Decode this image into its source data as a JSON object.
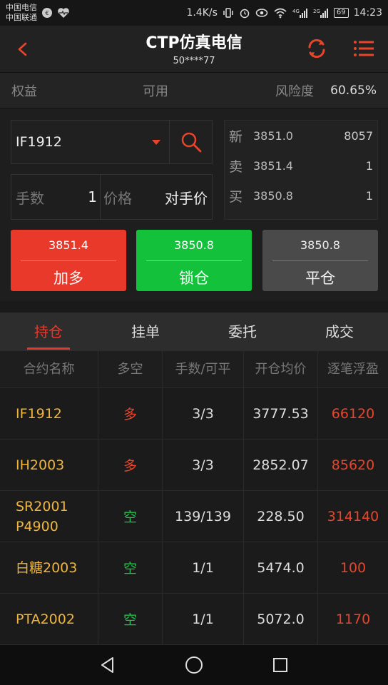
{
  "status_bar": {
    "carrier1": "中国电信",
    "carrier2": "中国联通",
    "speed": "1.4K/s",
    "battery": "69",
    "time": "14:23"
  },
  "nav": {
    "title": "CTP仿真电信",
    "account": "50****77"
  },
  "account_bar": {
    "equity_label": "权益",
    "available_label": "可用",
    "risk_label": "风险度",
    "risk_value": "60.65%"
  },
  "order": {
    "symbol": "IF1912",
    "qty_label": "手数",
    "qty_value": "1",
    "price_label": "价格",
    "price_value": "对手价"
  },
  "quote": {
    "rows": [
      {
        "label": "新",
        "price": "3851.0",
        "vol": "8057"
      },
      {
        "label": "卖",
        "price": "3851.4",
        "vol": "1"
      },
      {
        "label": "买",
        "price": "3850.8",
        "vol": "1"
      }
    ]
  },
  "buttons": {
    "buy_price": "3851.4",
    "buy_label": "加多",
    "lock_price": "3850.8",
    "lock_label": "锁仓",
    "close_price": "3850.8",
    "close_label": "平仓"
  },
  "tabs": [
    "持仓",
    "挂单",
    "委托",
    "成交"
  ],
  "table": {
    "headers": [
      "合约名称",
      "多空",
      "手数/可平",
      "开仓均价",
      "逐笔浮盈"
    ],
    "rows": [
      {
        "name": "IF1912",
        "dir": "多",
        "dir_type": "long",
        "qty": "3/3",
        "avg": "3777.53",
        "pnl": "66120"
      },
      {
        "name": "IH2003",
        "dir": "多",
        "dir_type": "long",
        "qty": "3/3",
        "avg": "2852.07",
        "pnl": "85620"
      },
      {
        "name": "SR2001\nP4900",
        "dir": "空",
        "dir_type": "short",
        "qty": "139/139",
        "avg": "228.50",
        "pnl": "314140"
      },
      {
        "name": "白糖2003",
        "dir": "空",
        "dir_type": "short",
        "qty": "1/1",
        "avg": "5474.0",
        "pnl": "100"
      },
      {
        "name": "PTA2002",
        "dir": "空",
        "dir_type": "short",
        "qty": "1/1",
        "avg": "5072.0",
        "pnl": "1170"
      }
    ]
  }
}
